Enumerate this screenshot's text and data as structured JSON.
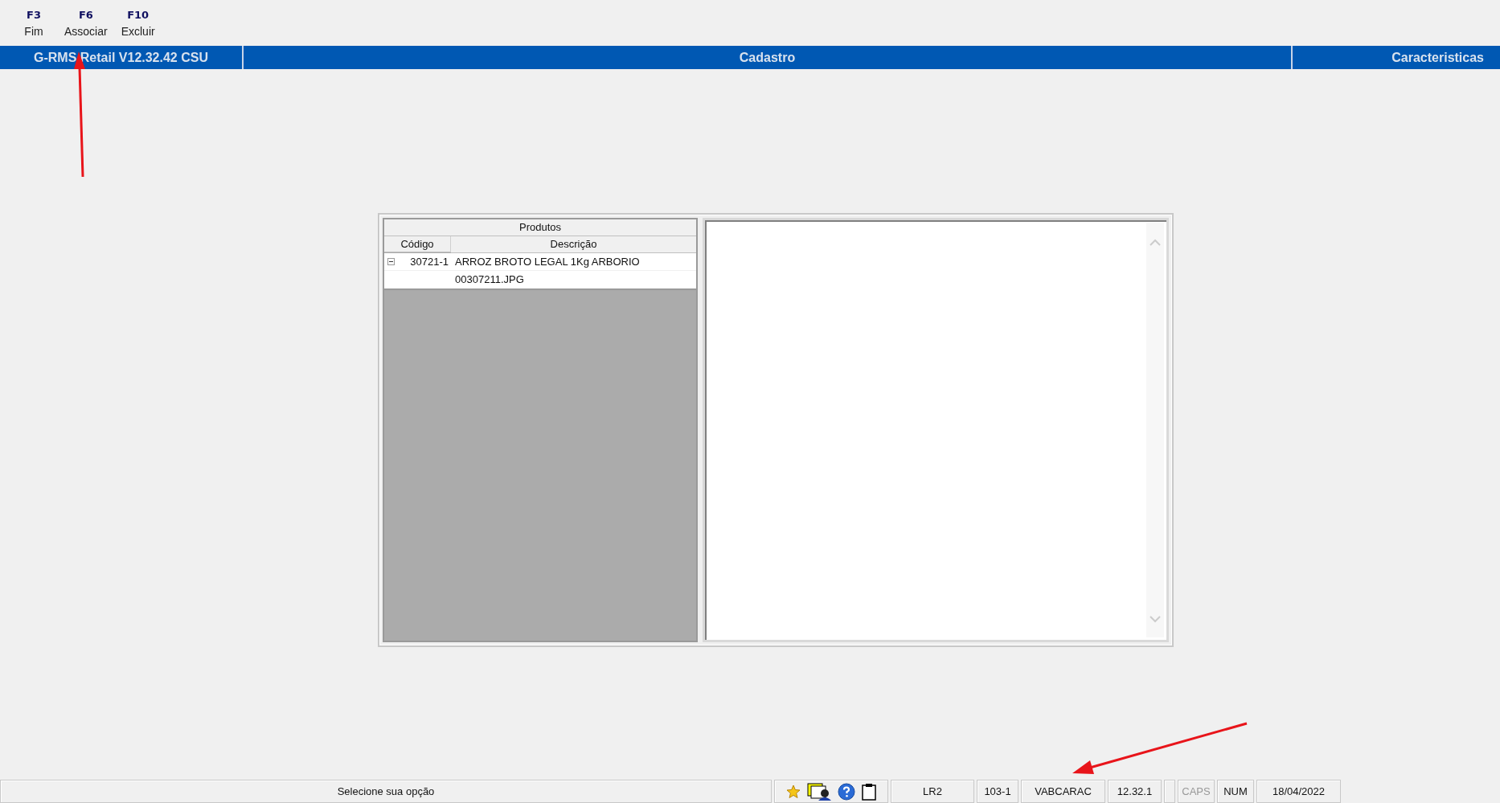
{
  "toolbar": [
    {
      "key": "F3",
      "label": "Fim"
    },
    {
      "key": "F6",
      "label": "Associar"
    },
    {
      "key": "F10",
      "label": "Excluir"
    }
  ],
  "header": {
    "app": "G-RMS Retail V12.32.42 CSU",
    "module": "Cadastro",
    "screen": "Caracteristicas"
  },
  "tree": {
    "title": "Produtos",
    "columns": [
      "Código",
      "Descrição"
    ],
    "rows": [
      {
        "codigo": "30721-1",
        "descricao": "ARROZ BROTO LEGAL 1Kg ARBORIO",
        "expanded": true,
        "children": [
          {
            "descricao": "00307211.JPG"
          }
        ]
      }
    ]
  },
  "status_bar": {
    "message": "Selecione sua opção",
    "fields": [
      "LR2",
      "103-1",
      "VABCARAC",
      "12.32.1"
    ],
    "indicators": [
      {
        "label": "CAPS",
        "on": false
      },
      {
        "label": "NUM",
        "on": true
      }
    ],
    "date": "18/04/2022"
  }
}
